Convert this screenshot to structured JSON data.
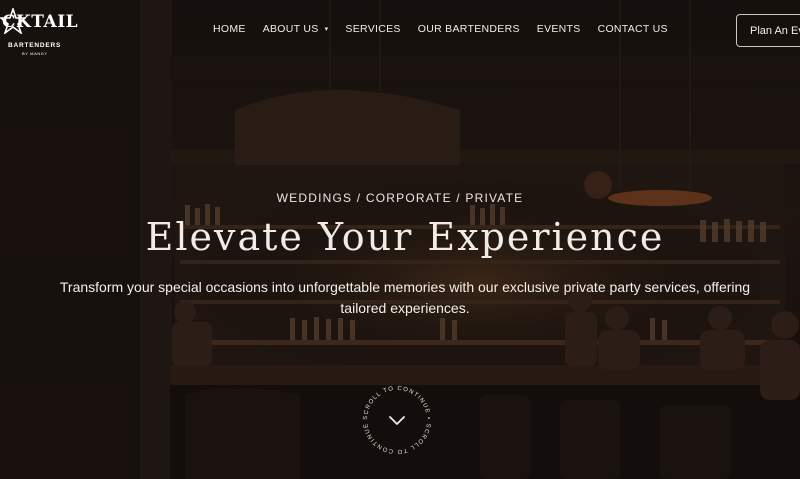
{
  "brand": {
    "logo_text": "CKTAIL",
    "logo_subtext": "BARTENDERS",
    "logo_byline": "BY MANDY"
  },
  "nav": {
    "items": [
      {
        "label": "HOME"
      },
      {
        "label": "ABOUT US",
        "has_dropdown": true
      },
      {
        "label": "SERVICES"
      },
      {
        "label": "OUR BARTENDERS"
      },
      {
        "label": "EVENTS"
      },
      {
        "label": "CONTACT US"
      }
    ],
    "cta_label": "Plan An Eve"
  },
  "hero": {
    "eyebrow": "WEDDINGS / CORPORATE / PRIVATE",
    "headline": "Elevate Your Experience",
    "description": "Transform your special occasions into unforgettable memories with our exclusive private party services, offering tailored experiences."
  },
  "scroll_badge": {
    "ring_text": "SCROLL TO CONTINUE • SCROLL TO CONTINUE •",
    "icon": "chevron-down-icon"
  },
  "colors": {
    "text": "#f2ece6",
    "background": "#1a1411",
    "accent_warm": "#c0713a"
  }
}
